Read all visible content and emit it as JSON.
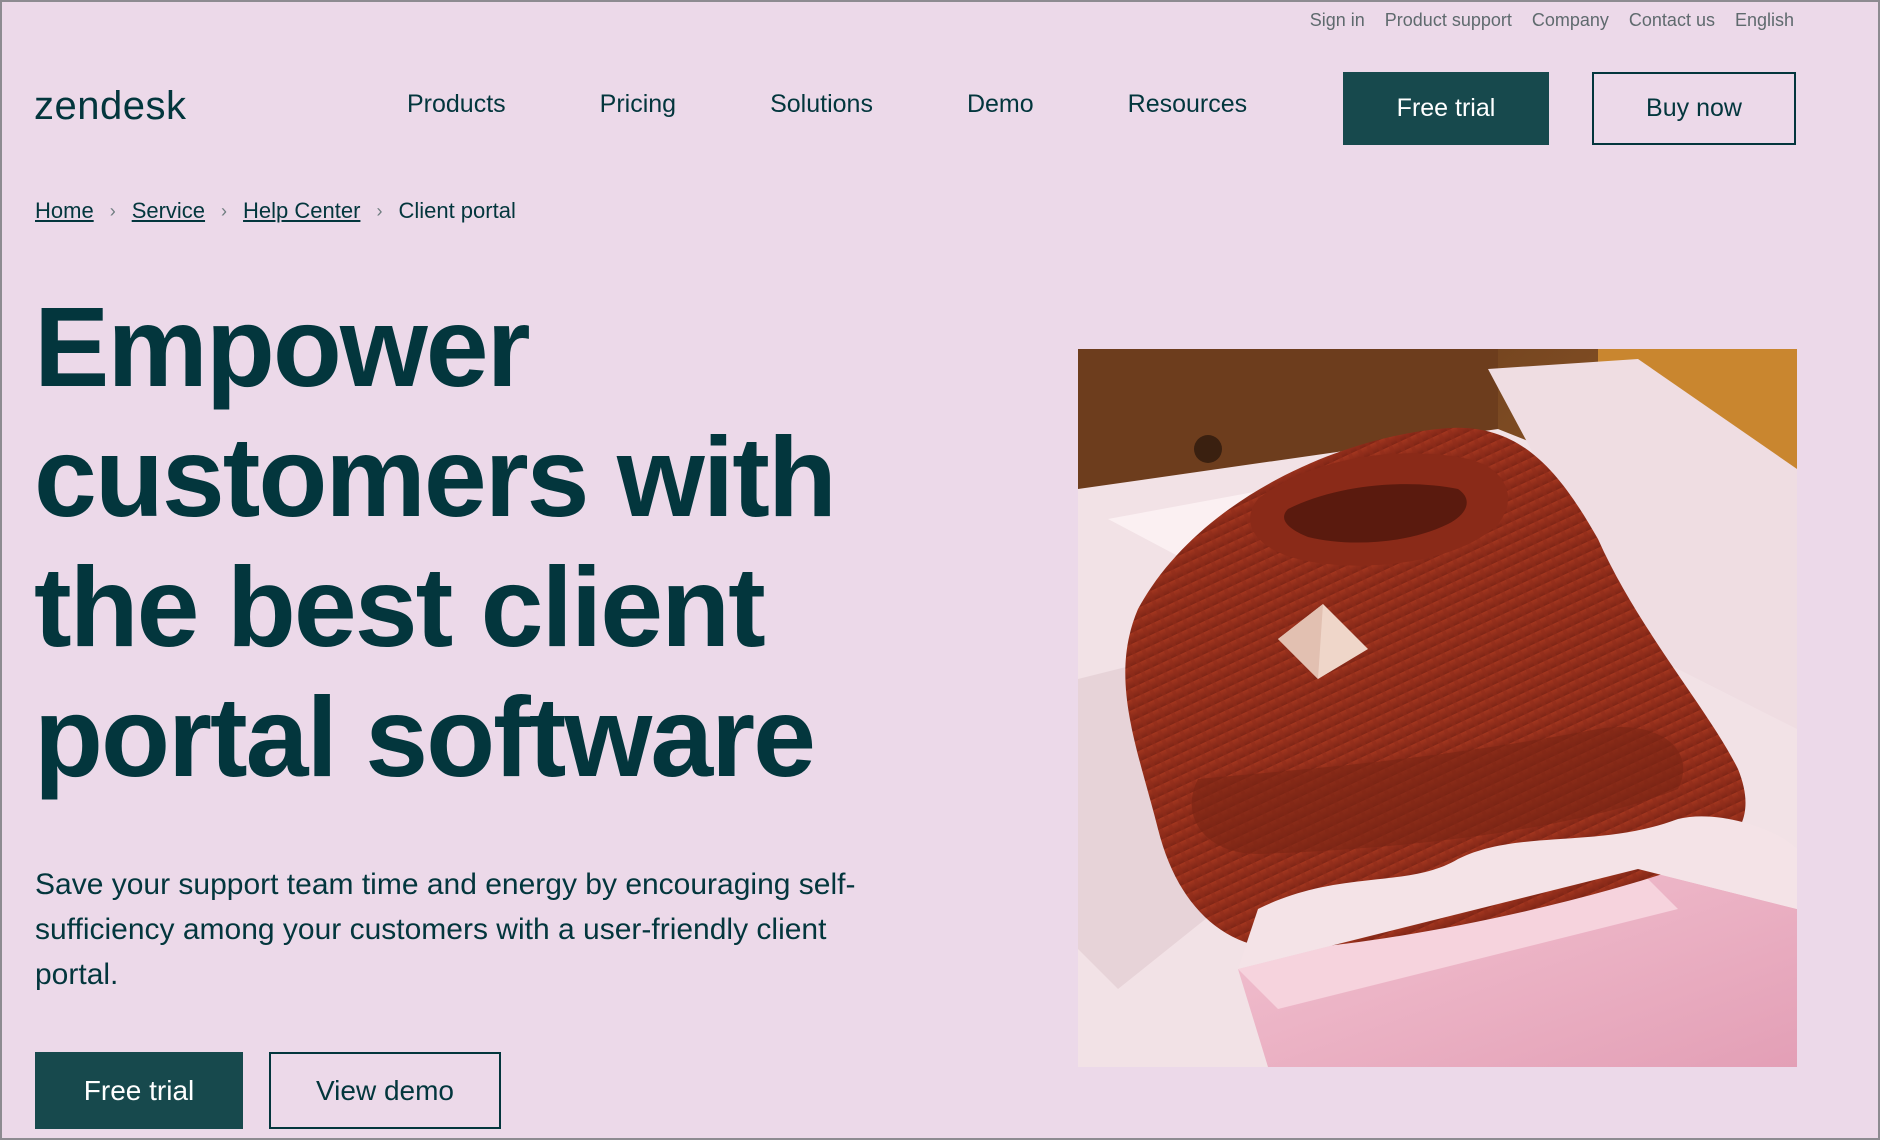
{
  "utility_nav": {
    "sign_in": "Sign in",
    "product_support": "Product support",
    "company": "Company",
    "contact_us": "Contact us",
    "language": "English"
  },
  "header": {
    "logo": "zendesk",
    "nav": {
      "products": "Products",
      "pricing": "Pricing",
      "solutions": "Solutions",
      "demo": "Demo",
      "resources": "Resources"
    },
    "free_trial": "Free trial",
    "buy_now": "Buy now"
  },
  "breadcrumb": {
    "items": [
      "Home",
      "Service",
      "Help Center"
    ],
    "current": "Client portal"
  },
  "hero": {
    "title_lines": [
      "Empower",
      "customers with",
      "the best client",
      "portal software"
    ],
    "subtitle": "Save your support team time and energy by encouraging self-sufficiency among your customers with a user-friendly client portal.",
    "free_trial": "Free trial",
    "view_demo": "View demo"
  },
  "colors": {
    "background": "#ecd9e9",
    "brand_dark": "#03363d",
    "button_primary": "#17494d"
  }
}
